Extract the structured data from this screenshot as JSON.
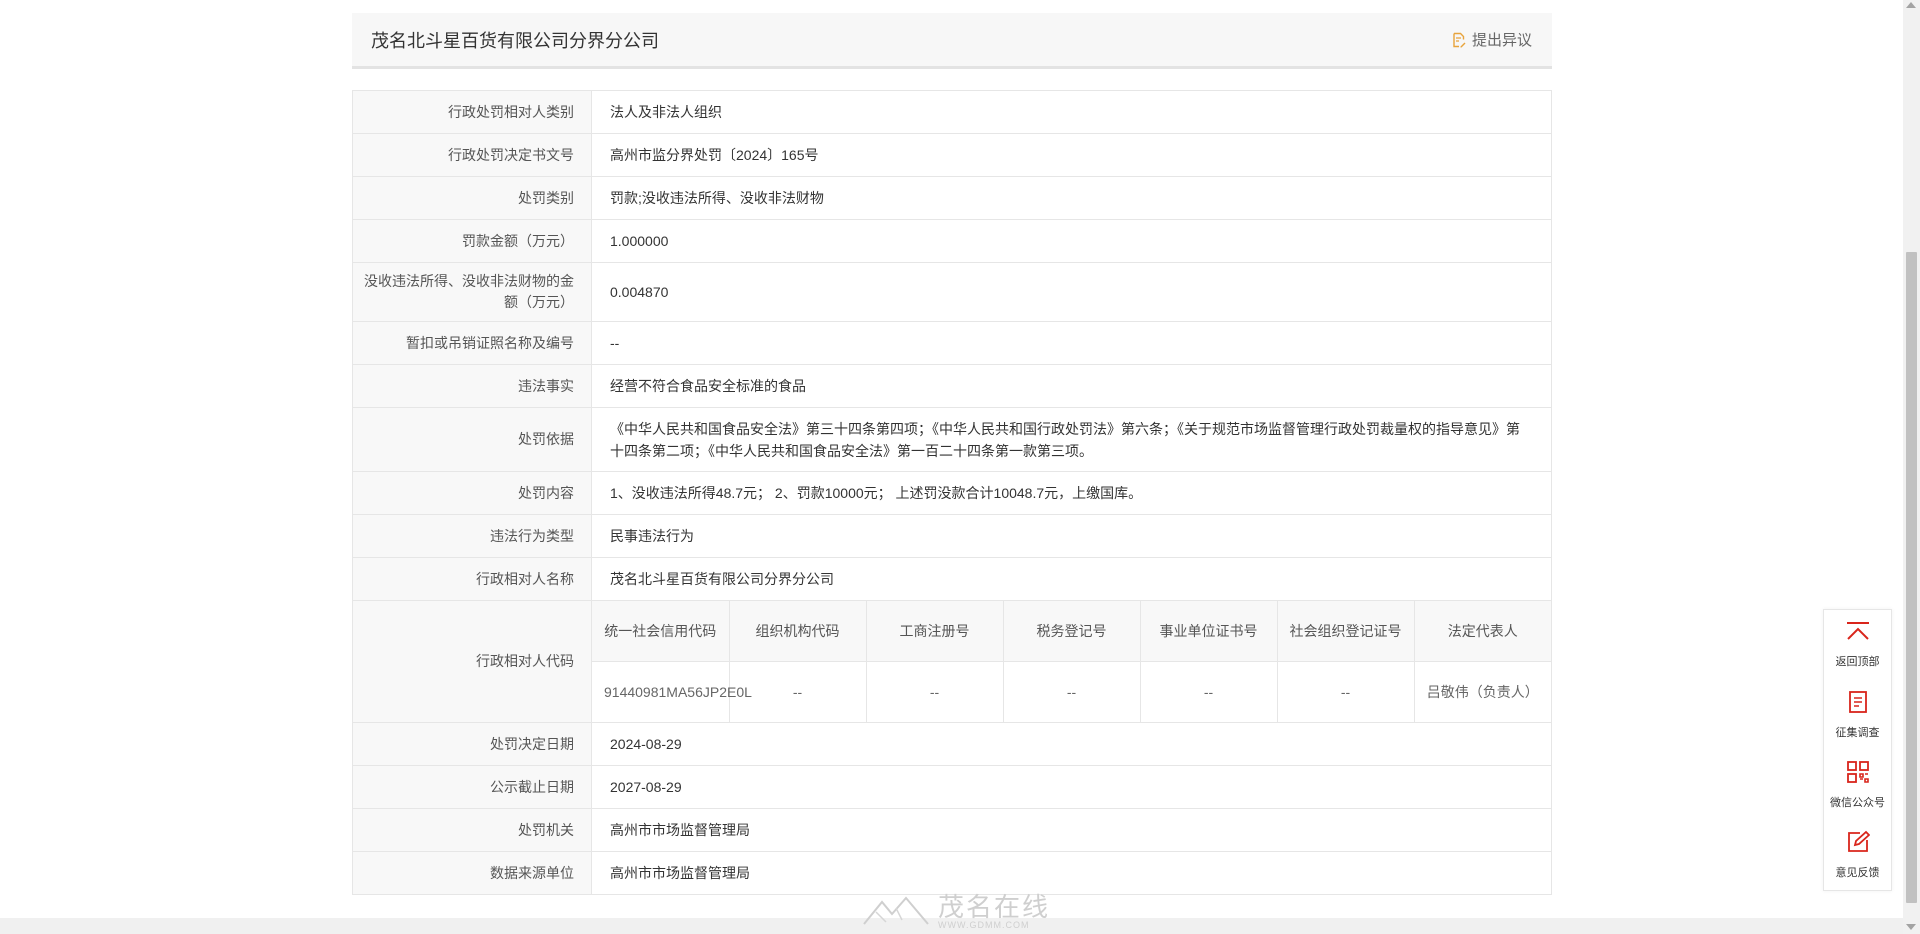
{
  "header": {
    "company_name": "茂名北斗星百货有限公司分界分公司",
    "objection_label": "提出异议"
  },
  "rows_top": [
    {
      "label": "行政处罚相对人类别",
      "value": "法人及非法人组织"
    },
    {
      "label": "行政处罚决定书文号",
      "value": "高州市监分界处罚〔2024〕165号"
    },
    {
      "label": "处罚类别",
      "value": "罚款;没收违法所得、没收非法财物"
    },
    {
      "label": "罚款金额（万元）",
      "value": "1.000000"
    },
    {
      "label": "没收违法所得、没收非法财物的金额（万元）",
      "value": "0.004870"
    },
    {
      "label": "暂扣或吊销证照名称及编号",
      "value": "--"
    },
    {
      "label": "违法事实",
      "value": "经营不符合食品安全标准的食品"
    },
    {
      "label": "处罚依据",
      "value": "《中华人民共和国食品安全法》第三十四条第四项；《中华人民共和国行政处罚法》第六条；《关于规范市场监督管理行政处罚裁量权的指导意见》第十四条第二项；《中华人民共和国食品安全法》第一百二十四条第一款第三项。"
    },
    {
      "label": "处罚内容",
      "value": "1、没收违法所得48.7元； 2、罚款10000元； 上述罚没款合计10048.7元，上缴国库。"
    },
    {
      "label": "违法行为类型",
      "value": "民事违法行为"
    },
    {
      "label": "行政相对人名称",
      "value": "茂名北斗星百货有限公司分界分公司"
    }
  ],
  "codes": {
    "label": "行政相对人代码",
    "headers": [
      "统一社会信用代码",
      "组织机构代码",
      "工商注册号",
      "税务登记号",
      "事业单位证书号",
      "社会组织登记证号",
      "法定代表人"
    ],
    "values": [
      "91440981MA56JP2E0L",
      "--",
      "--",
      "--",
      "--",
      "--",
      "吕敬伟（负责人）"
    ]
  },
  "rows_bottom": [
    {
      "label": "处罚决定日期",
      "value": "2024-08-29"
    },
    {
      "label": "公示截止日期",
      "value": "2027-08-29"
    },
    {
      "label": "处罚机关",
      "value": "高州市市场监督管理局"
    },
    {
      "label": "数据来源单位",
      "value": "高州市市场监督管理局"
    }
  ],
  "sidebar": [
    {
      "label": "返回顶部",
      "icon": "back-to-top-icon"
    },
    {
      "label": "征集调查",
      "icon": "survey-icon"
    },
    {
      "label": "微信公众号",
      "icon": "qr-code-icon"
    },
    {
      "label": "意见反馈",
      "icon": "feedback-edit-icon"
    }
  ],
  "colors": {
    "accent_red": "#d9251b",
    "objection_icon": "#e8a33b"
  }
}
